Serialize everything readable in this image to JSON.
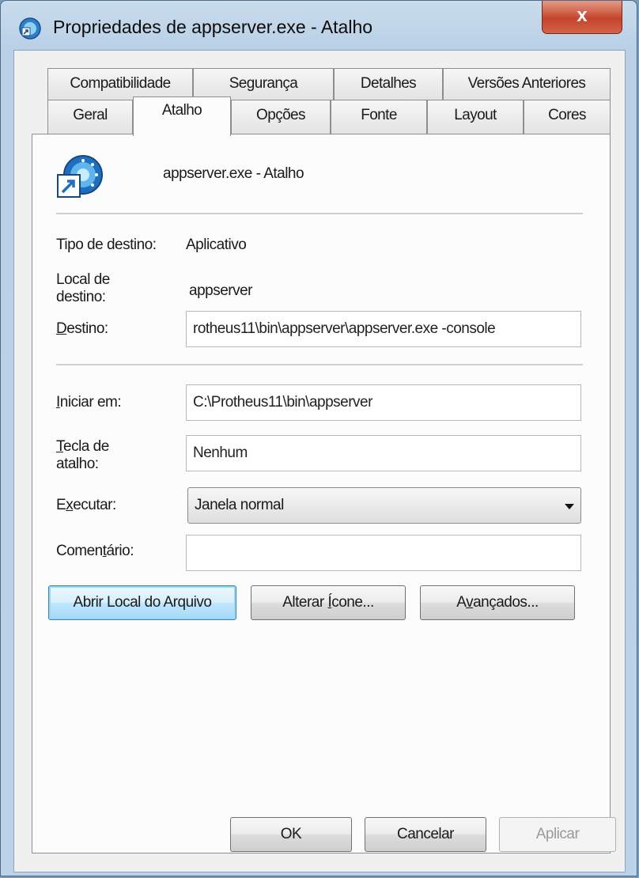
{
  "window": {
    "title": "Propriedades de appserver.exe - Atalho",
    "close_label": "x"
  },
  "tabs": {
    "row1": [
      "Compatibilidade",
      "Segurança",
      "Detalhes",
      "Versões Anteriores"
    ],
    "row2": [
      "Geral",
      "Atalho",
      "Opções",
      "Fonte",
      "Layout",
      "Cores"
    ],
    "active": "Atalho"
  },
  "shortcut": {
    "name": "appserver.exe - Atalho",
    "icon": "shortcut-icon"
  },
  "form": {
    "tipo_label": "Tipo de destino:",
    "tipo_value": "Aplicativo",
    "local_label_1": "Local de",
    "local_label_2": "destino:",
    "local_value": "appserver",
    "destino_label_ul": "D",
    "destino_label_rest": "estino:",
    "destino_value": "rotheus11\\bin\\appserver\\appserver.exe -console",
    "iniciar_label_ul": "I",
    "iniciar_label_rest": "niciar em:",
    "iniciar_value": "C:\\Protheus11\\bin\\appserver",
    "tecla_label_ul": "T",
    "tecla_label_rest1": "ecla de",
    "tecla_label_2": "atalho:",
    "tecla_value": "Nenhum",
    "executar_label_a": "E",
    "executar_label_ul": "x",
    "executar_label_b": "ecutar:",
    "executar_value": "Janela normal",
    "comentario_label_a": "Comen",
    "comentario_label_ul": "t",
    "comentario_label_b": "ário:",
    "comentario_value": ""
  },
  "buttons": {
    "abrir_local": "Abrir Local do Arquivo",
    "alterar_icone_a": "Alterar ",
    "alterar_icone_ul": "Í",
    "alterar_icone_b": "cone...",
    "avancados_a": "A",
    "avancados_ul": "v",
    "avancados_b": "ançados...",
    "ok": "OK",
    "cancelar": "Cancelar",
    "aplicar": "Aplicar"
  }
}
